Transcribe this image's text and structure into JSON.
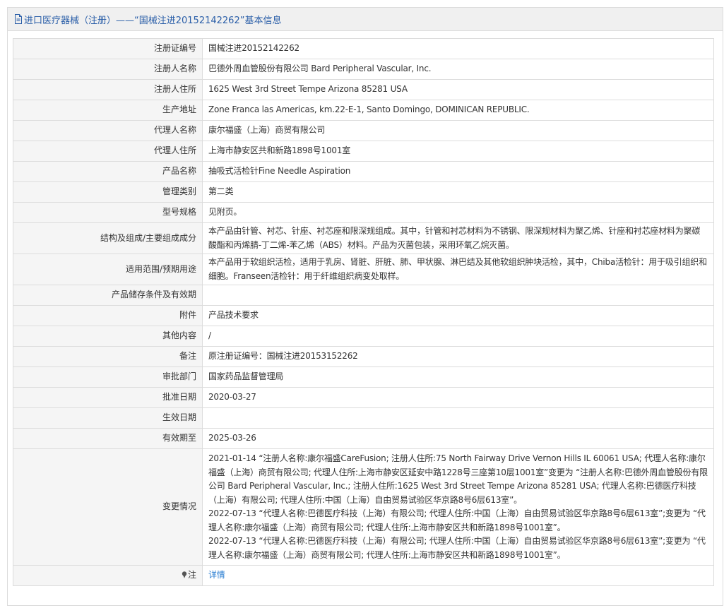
{
  "header": {
    "title": "进口医疗器械（注册）——“国械注进20152142262”基本信息"
  },
  "fields": [
    {
      "label": "注册证编号",
      "value": "国械注进20152142262"
    },
    {
      "label": "注册人名称",
      "value": "巴德外周血管股份有限公司 Bard Peripheral Vascular, Inc."
    },
    {
      "label": "注册人住所",
      "value": "1625 West 3rd Street Tempe Arizona 85281 USA"
    },
    {
      "label": "生产地址",
      "value": "Zone Franca las Americas, km.22-E-1, Santo Domingo, DOMINICAN REPUBLIC."
    },
    {
      "label": "代理人名称",
      "value": "康尔福盛（上海）商贸有限公司"
    },
    {
      "label": "代理人住所",
      "value": "上海市静安区共和新路1898号1001室"
    },
    {
      "label": "产品名称",
      "value": "抽吸式活检针Fine Needle Aspiration"
    },
    {
      "label": "管理类别",
      "value": "第二类"
    },
    {
      "label": "型号规格",
      "value": "见附页。"
    },
    {
      "label": "结构及组成/主要组成成分",
      "value": "本产品由针管、衬芯、针座、衬芯座和限深规组成。其中，针管和衬芯材料为不锈钢、限深规材料为聚乙烯、针座和衬芯座材料为聚碳酸酯和丙烯腈-丁二烯-苯乙烯（ABS）材料。产品为灭菌包装，采用环氧乙烷灭菌。"
    },
    {
      "label": "适用范围/预期用途",
      "value": "本产品用于软组织活检，适用于乳房、肾脏、肝脏、肺、甲状腺、淋巴结及其他软组织肿块活检，其中，Chiba活检针：用于吸引组织和细胞。Franseen活检针：用于纤维组织病变处取样。"
    },
    {
      "label": "产品储存条件及有效期",
      "value": ""
    },
    {
      "label": "附件",
      "value": "产品技术要求"
    },
    {
      "label": "其他内容",
      "value": "/"
    },
    {
      "label": "备注",
      "value": "原注册证编号：国械注进20153152262"
    },
    {
      "label": "审批部门",
      "value": "国家药品监督管理局"
    },
    {
      "label": "批准日期",
      "value": "2020-03-27"
    },
    {
      "label": "生效日期",
      "value": ""
    },
    {
      "label": "有效期至",
      "value": "2025-03-26"
    }
  ],
  "change_history": {
    "label": "变更情况",
    "entries": [
      "2021-01-14 “注册人名称:康尔福盛CareFusion; 注册人住所:75 North Fairway Drive Vernon Hills IL 60061 USA; 代理人名称:康尔福盛（上海）商贸有限公司; 代理人住所:上海市静安区延安中路1228号三座第10层1001室”变更为 “注册人名称:巴德外周血管股份有限公司 Bard Peripheral Vascular, Inc.; 注册人住所:1625 West 3rd Street Tempe Arizona 85281 USA; 代理人名称:巴德医疗科技（上海）有限公司; 代理人住所:中国（上海）自由贸易试验区华京路8号6层613室”。",
      "2022-07-13 “代理人名称:巴德医疗科技（上海）有限公司; 代理人住所:中国（上海）自由贸易试验区华京路8号6层613室”;变更为 “代理人名称:康尔福盛（上海）商贸有限公司; 代理人住所:上海市静安区共和新路1898号1001室”。",
      "2022-07-13 “代理人名称:巴德医疗科技（上海）有限公司; 代理人住所:中国（上海）自由贸易试验区华京路8号6层613室”;变更为 “代理人名称:康尔福盛（上海）商贸有限公司; 代理人住所:上海市静安区共和新路1898号1001室”。"
    ]
  },
  "note": {
    "label": "注",
    "link_text": "详情",
    "icon": "pin-icon"
  },
  "icons": {
    "header_icon": "document-icon"
  },
  "colors": {
    "header_text": "#2a5ea8",
    "link": "#2a7ed2",
    "label_bg": "#f5f5f5",
    "header_bg": "#f0f0f0",
    "border": "#dcdcdc"
  }
}
